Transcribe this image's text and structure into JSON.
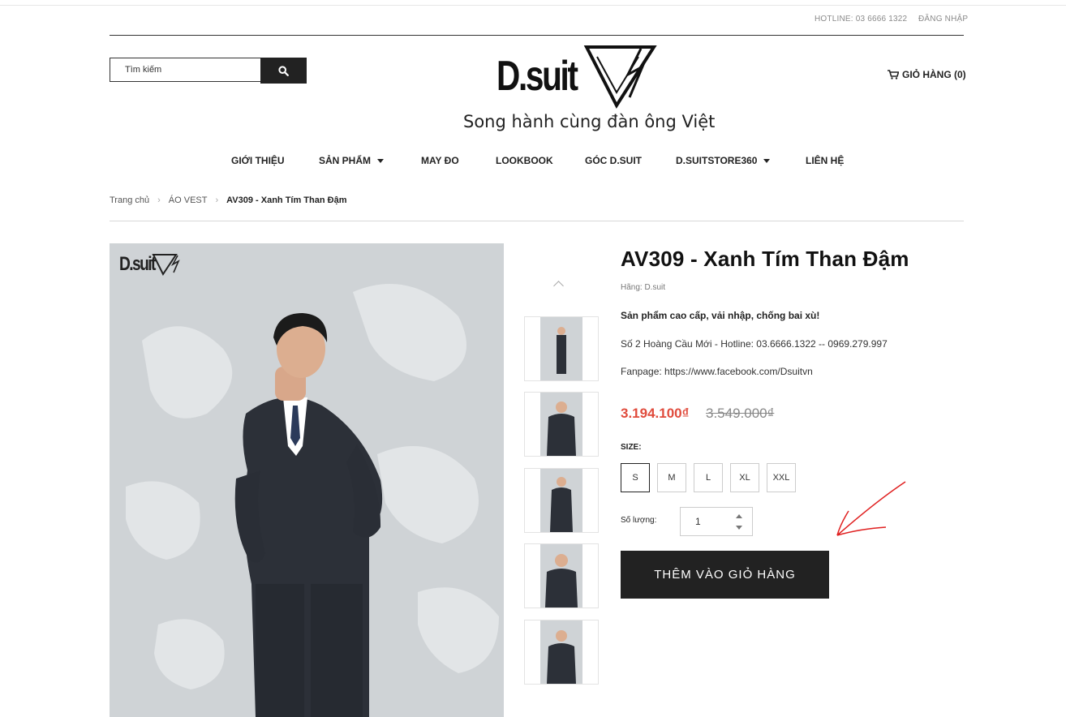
{
  "topbar": {
    "hotline": "HOTLINE: 03 6666 1322",
    "login": "ĐĂNG NHẬP"
  },
  "search": {
    "placeholder": "Tìm kiếm",
    "button_icon": "search-icon"
  },
  "logo": {
    "text": "D.suit",
    "tagline": "Song hành cùng đàn ông Việt"
  },
  "cart": {
    "label": "GIỎ HÀNG (0)",
    "icon": "cart-icon"
  },
  "nav": [
    {
      "label": "GIỚI THIỆU"
    },
    {
      "label": "SẢN PHẨM",
      "dropdown": true
    },
    {
      "label": "MAY ĐO"
    },
    {
      "label": "LOOKBOOK"
    },
    {
      "label": "GÓC D.SUIT"
    },
    {
      "label": "D.SUITSTORE360",
      "dropdown": true
    },
    {
      "label": "LIÊN HỆ"
    }
  ],
  "breadcrumb": {
    "home": "Trang chủ",
    "category": "ÁO VEST",
    "current": "AV309 - Xanh Tím Than Đậm"
  },
  "gallery": {
    "image_logo": "D.suit",
    "thumbnail_count": 5
  },
  "product": {
    "title": "AV309 - Xanh Tím Than Đậm",
    "brand": "Hãng: D.suit",
    "desc_bold": "Sản phẩm cao cấp, vải nhập, chống bai xù!",
    "address": "Số 2 Hoàng Cầu Mới - Hotline: 03.6666.1322 -- 0969.279.997",
    "fanpage": "Fanpage: https://www.facebook.com/Dsuitvn",
    "price": "3.194.100₫",
    "old_price": "3.549.000₫",
    "size_label": "SIZE:",
    "sizes": [
      "S",
      "M",
      "L",
      "XL",
      "XXL"
    ],
    "selected_size": "S",
    "qty_label": "Số lượng:",
    "qty": "1",
    "add_to_cart": "THÊM VÀO GIỎ HÀNG"
  },
  "colors": {
    "price": "#e04b3c",
    "button": "#222222",
    "arrow": "#e02020"
  }
}
